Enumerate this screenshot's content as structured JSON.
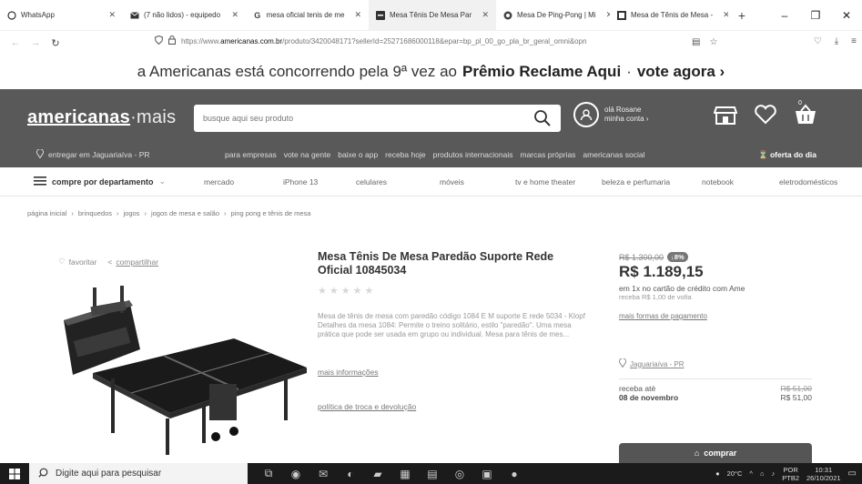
{
  "browser": {
    "tabs": [
      {
        "title": "WhatsApp",
        "icon": "whatsapp-icon",
        "active": false
      },
      {
        "title": "(7 não lidos) - equipedo",
        "icon": "mail-icon",
        "active": false
      },
      {
        "title": "mesa oficial tenis de me",
        "icon": "google-icon",
        "active": false
      },
      {
        "title": "Mesa Tênis De Mesa Par",
        "icon": "americanas-icon",
        "active": true
      },
      {
        "title": "Mesa De Ping-Pong | Mi",
        "icon": "shop-icon",
        "active": false
      },
      {
        "title": "Mesa de Tênis de Mesa -",
        "icon": "store-icon",
        "active": false
      }
    ],
    "new_tab": "+",
    "window_controls": [
      "–",
      "❐",
      "✕"
    ],
    "url_prefix": "https://www.",
    "url_domain": "americanas.com.br",
    "url_rest": "/produto/3420048171?sellerId=25271686000118&epar=bp_pl_00_go_pla_br_geral_omni&opn",
    "close_glyph": "✕"
  },
  "promo": {
    "lead": "a Americanas está concorrendo pela 9ª vez ao",
    "bold": "Prêmio Reclame Aqui",
    "sep": "·",
    "cta": "vote agora ›"
  },
  "header": {
    "logo_main": "americanas",
    "logo_suffix": "·mais",
    "search_placeholder": "busque aqui seu produto",
    "user_line1": "olá Rosane",
    "user_line2": "minha conta ›",
    "cart_count": "0",
    "deliver": "entregar em Jaguariaíva - PR",
    "links": [
      "para empresas",
      "vote na gente",
      "baixe o app",
      "receba hoje",
      "produtos internacionais",
      "marcas próprias",
      "americanas social"
    ],
    "offer": "oferta do dia"
  },
  "departments": {
    "button": "compre por departamento",
    "items": [
      "mercado",
      "iPhone 13",
      "celulares",
      "móveis",
      "tv e home theater",
      "beleza e perfumaria",
      "notebook",
      "eletrodomésticos"
    ]
  },
  "breadcrumb": [
    "página inicial",
    "brinquedos",
    "jogos",
    "jogos de mesa e salão",
    "ping pong e tênis de mesa"
  ],
  "product": {
    "share_like": "favoritar",
    "share_label": "compartilhar",
    "title": "Mesa Tênis De Mesa Paredão Suporte Rede Oficial 10845034",
    "description": "Mesa de tênis de mesa com paredão código 1084 E M suporte E rede 5034 - Klopf Detalhes da mesa 1084: Permite o treino solitário, estilo \"paredão\". Uma mesa prática que pode ser usada em grupo ou individual. Mesa para tênis de mes...",
    "more_info": "mais informações",
    "policy": "política de troca e devolução"
  },
  "pricing": {
    "old_price": "R$ 1.300,00",
    "discount": "8%",
    "price": "R$ 1.189,15",
    "ame": "em 1x no cartão de crédito com Ame",
    "cashback": "receba R$ 1,00 de volta",
    "payments": "mais formas de pagamento",
    "location": "Jaguariaíva - PR",
    "ship_label": "receba até",
    "ship_date": "08 de novembro",
    "ship_price_old": "R$ 51,00",
    "ship_price": "R$ 51,00",
    "buy": "comprar"
  },
  "taskbar": {
    "search_placeholder": "Digite aqui para pesquisar",
    "temp": "20°C",
    "lang1": "POR",
    "lang2": "PTB2",
    "time": "10:31",
    "date": "26/10/2021"
  }
}
